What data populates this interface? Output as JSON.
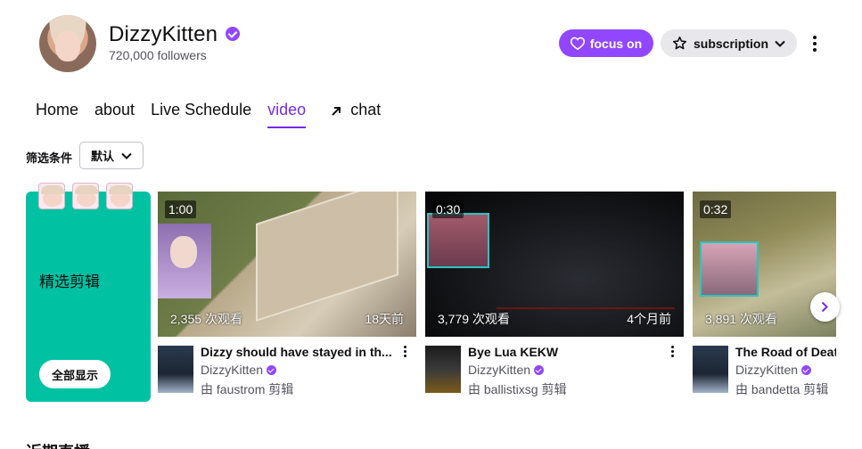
{
  "channel": {
    "name": "DizzyKitten",
    "followers": "720,000 followers",
    "follow_label": "focus on",
    "subscribe_label": "subscription"
  },
  "tabs": [
    {
      "label": "Home"
    },
    {
      "label": "about"
    },
    {
      "label": "Live Schedule"
    },
    {
      "label": "video"
    },
    {
      "label": "chat"
    }
  ],
  "filter": {
    "label": "筛选条件",
    "selected": "默认"
  },
  "featured": {
    "title": "精选剪辑",
    "show_all": "全部显示"
  },
  "clips": [
    {
      "duration": "1:00",
      "views": "2,355 次观看",
      "age": "18天前",
      "title": "Dizzy should have stayed in th...",
      "channel": "DizzyKitten",
      "by": "由 faustrom 剪辑"
    },
    {
      "duration": "0:30",
      "views": "3,779 次观看",
      "age": "4个月前",
      "title": "Bye Lua KEKW",
      "channel": "DizzyKitten",
      "by": "由 ballistixsg 剪辑"
    },
    {
      "duration": "0:32",
      "views": "3,891 次观看",
      "age": "",
      "title": "The Road of Deat",
      "channel": "DizzyKitten",
      "by": "由 bandetta 剪辑"
    }
  ],
  "bottom_heading": "近期直播",
  "colors": {
    "accent": "#9147ff",
    "active_tab": "#772ce8",
    "featured_panel": "#00c2a3"
  }
}
